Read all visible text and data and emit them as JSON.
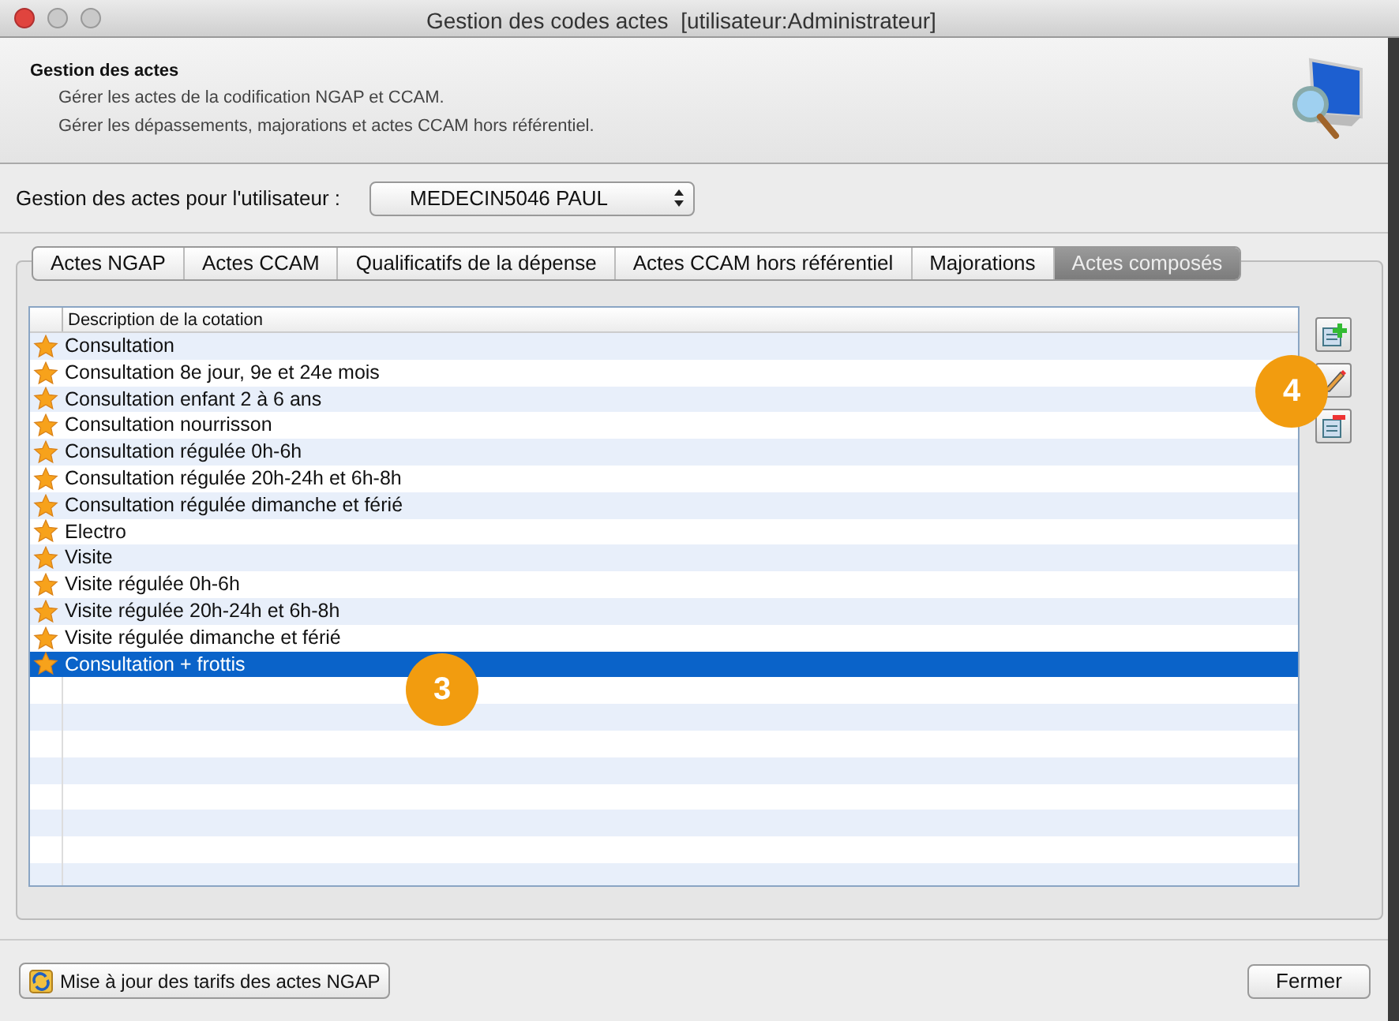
{
  "window": {
    "title": "Gestion des codes actes  [utilisateur:Administrateur]"
  },
  "header": {
    "title": "Gestion des actes",
    "lines": [
      "Gérer les actes de la codification NGAP et CCAM.",
      "Gérer les dépassements, majorations et actes CCAM hors référentiel."
    ]
  },
  "user_row": {
    "label": "Gestion des actes pour l'utilisateur :",
    "value": "MEDECIN5046 PAUL"
  },
  "tabs": [
    {
      "label": "Actes NGAP",
      "selected": false
    },
    {
      "label": "Actes CCAM",
      "selected": false
    },
    {
      "label": "Qualificatifs de la dépense",
      "selected": false
    },
    {
      "label": "Actes CCAM hors référentiel",
      "selected": false
    },
    {
      "label": "Majorations",
      "selected": false
    },
    {
      "label": "Actes composés",
      "selected": true
    }
  ],
  "table": {
    "columns": [
      "Description de la cotation"
    ],
    "rows": [
      {
        "text": "Consultation",
        "selected": false
      },
      {
        "text": "Consultation 8e jour, 9e et 24e mois",
        "selected": false
      },
      {
        "text": "Consultation enfant 2 à 6 ans",
        "selected": false
      },
      {
        "text": "Consultation nourrisson",
        "selected": false
      },
      {
        "text": "Consultation régulée 0h-6h",
        "selected": false
      },
      {
        "text": "Consultation régulée 20h-24h et 6h-8h",
        "selected": false
      },
      {
        "text": "Consultation régulée dimanche et férié",
        "selected": false
      },
      {
        "text": "Electro",
        "selected": false
      },
      {
        "text": "Visite",
        "selected": false
      },
      {
        "text": "Visite régulée 0h-6h",
        "selected": false
      },
      {
        "text": "Visite régulée 20h-24h et 6h-8h",
        "selected": false
      },
      {
        "text": "Visite régulée dimanche et férié",
        "selected": false
      },
      {
        "text": "Consultation + frottis",
        "selected": true
      }
    ]
  },
  "callouts": [
    {
      "number": "3"
    },
    {
      "number": "4"
    }
  ],
  "footer": {
    "update_button": "Mise à jour des tarifs des actes NGAP",
    "close_button": "Fermer"
  }
}
